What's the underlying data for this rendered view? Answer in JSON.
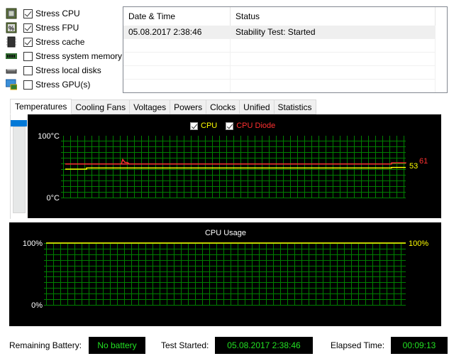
{
  "stress_options": [
    {
      "label": "Stress CPU",
      "checked": true,
      "icon": "cpu-chip-icon"
    },
    {
      "label": "Stress FPU",
      "checked": true,
      "icon": "fpu-percent-icon"
    },
    {
      "label": "Stress cache",
      "checked": true,
      "icon": "cache-chip-icon"
    },
    {
      "label": "Stress system memory",
      "checked": false,
      "icon": "memory-module-icon"
    },
    {
      "label": "Stress local disks",
      "checked": false,
      "icon": "hard-disk-icon"
    },
    {
      "label": "Stress GPU(s)",
      "checked": false,
      "icon": "gpu-monitor-icon"
    }
  ],
  "log": {
    "columns": [
      "Date & Time",
      "Status"
    ],
    "rows": [
      [
        "05.08.2017 2:38:46",
        "Stability Test: Started"
      ]
    ]
  },
  "tabs": [
    "Temperatures",
    "Cooling Fans",
    "Voltages",
    "Powers",
    "Clocks",
    "Unified",
    "Statistics"
  ],
  "active_tab": "Temperatures",
  "colors": {
    "grid": "#008000",
    "cpu": "#ffff00",
    "cpu_diode": "#ff3030",
    "label_text": "#ffffff",
    "status_text": "#22e022"
  },
  "chart_data": [
    {
      "type": "line",
      "title": "Temperatures",
      "legend": [
        {
          "name": "CPU",
          "checked": true,
          "color": "#ffff00"
        },
        {
          "name": "CPU Diode",
          "checked": true,
          "color": "#ff3030"
        }
      ],
      "legend_position": "top-center",
      "ylabel_top": "100°C",
      "ylabel_bottom": "0°C",
      "ylim": [
        0,
        100
      ],
      "grid": true,
      "x_samples": 49,
      "series": [
        {
          "name": "CPU",
          "color": "#ffff00",
          "current_value": "53",
          "values": [
            50,
            50,
            50,
            52,
            52,
            52,
            52,
            52,
            52,
            52,
            52,
            52,
            52,
            52,
            52,
            52,
            52,
            52,
            52,
            52,
            52,
            52,
            52,
            52,
            52,
            52,
            52,
            52,
            52,
            52,
            52,
            52,
            52,
            52,
            52,
            52,
            52,
            52,
            52,
            52,
            52,
            52,
            52,
            52,
            52,
            52,
            53,
            53,
            53
          ]
        },
        {
          "name": "CPU Diode",
          "color": "#ff3030",
          "current_value": "61",
          "values": [
            59,
            59,
            59,
            59,
            59,
            59,
            59,
            59,
            59,
            59,
            59,
            59,
            59,
            59,
            59,
            59,
            59,
            59,
            59,
            59,
            59,
            59,
            59,
            59,
            59,
            59,
            59,
            59,
            59,
            59,
            59,
            59,
            59,
            59,
            59,
            59,
            59,
            59,
            59,
            59,
            59,
            59,
            59,
            59,
            59,
            59,
            61,
            61,
            60
          ]
        }
      ],
      "spike": {
        "series": "CPU Diode",
        "index": 8,
        "peak": 67
      }
    },
    {
      "type": "line",
      "title": "CPU Usage",
      "ylabel_top": "100%",
      "ylabel_bottom": "0%",
      "ylim": [
        0,
        100
      ],
      "grid": true,
      "series": [
        {
          "name": "CPU Usage",
          "color": "#ffff00",
          "current_value": "100%",
          "values": [
            100,
            100,
            100,
            100,
            100,
            100,
            100,
            100,
            100,
            100,
            100,
            100,
            100,
            100,
            100,
            100,
            100,
            100,
            100,
            100,
            100,
            100,
            100,
            100,
            100,
            100,
            100,
            100,
            100,
            100,
            100,
            100,
            100,
            100,
            100,
            100,
            100,
            100,
            100,
            100,
            100,
            100,
            100,
            100,
            100,
            100,
            100,
            100,
            100,
            100,
            100
          ]
        }
      ]
    }
  ],
  "footer": {
    "battery_label": "Remaining Battery:",
    "battery_value": "No battery",
    "started_label": "Test Started:",
    "started_value": "05.08.2017 2:38:46",
    "elapsed_label": "Elapsed Time:",
    "elapsed_value": "00:09:13"
  }
}
